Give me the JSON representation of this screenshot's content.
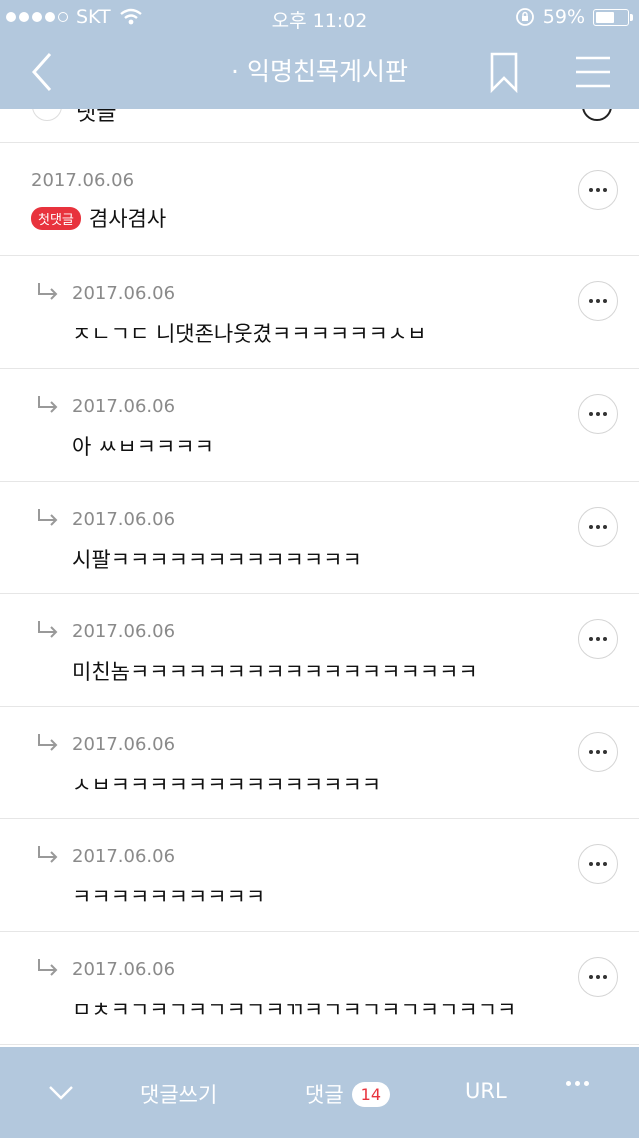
{
  "status_bar": {
    "carrier": "SKT",
    "time": "오후 11:02",
    "battery": "59%",
    "battery_level": 0.59
  },
  "nav": {
    "title": "· 익명친목게시판"
  },
  "partial_comment": {
    "text": "댓글"
  },
  "comments": [
    {
      "date": "2017.06.06",
      "text": "겸사겸사",
      "badge": "첫댓글",
      "reply": false
    },
    {
      "date": "2017.06.06",
      "text": "ㅈㄴㄱㄷ 니댓존나웃겼ㅋㅋㅋㅋㅋㅋㅅㅂ",
      "reply": true
    },
    {
      "date": "2017.06.06",
      "text": "아 ㅆㅂㅋㅋㅋㅋ",
      "reply": true
    },
    {
      "date": "2017.06.06",
      "text": "시팔ㅋㅋㅋㅋㅋㅋㅋㅋㅋㅋㅋㅋㅋ",
      "reply": true
    },
    {
      "date": "2017.06.06",
      "text": "미친놈ㅋㅋㅋㅋㅋㅋㅋㅋㅋㅋㅋㅋㅋㅋㅋㅋㅋㅋ",
      "reply": true
    },
    {
      "date": "2017.06.06",
      "text": "ㅅㅂㅋㅋㅋㅋㅋㅋㅋㅋㅋㅋㅋㅋㅋㅋ",
      "reply": true
    },
    {
      "date": "2017.06.06",
      "text": "ㅋㅋㅋㅋㅋㅋㅋㅋㅋㅋ",
      "reply": true
    },
    {
      "date": "2017.06.06",
      "text": "ㅁㅊㅋㄱㅋㄱㅋㄱㅋㄱㅋㄲㅋㄱㅋㄱㅋㄱㅋㄱㅋㄱㅋ",
      "reply": true
    }
  ],
  "bottom_bar": {
    "write_label": "댓글쓰기",
    "comments_label": "댓글",
    "comments_count": "14",
    "url_label": "URL"
  },
  "colors": {
    "header_bg": "#b3c8dd",
    "badge_red": "#e8333d"
  },
  "icons": [
    "back-arrow-icon",
    "bookmark-icon",
    "hamburger-menu-icon",
    "reply-arrow-icon",
    "more-dots-icon",
    "chevron-down-icon",
    "wifi-icon",
    "lock-rotation-icon",
    "battery-icon"
  ]
}
